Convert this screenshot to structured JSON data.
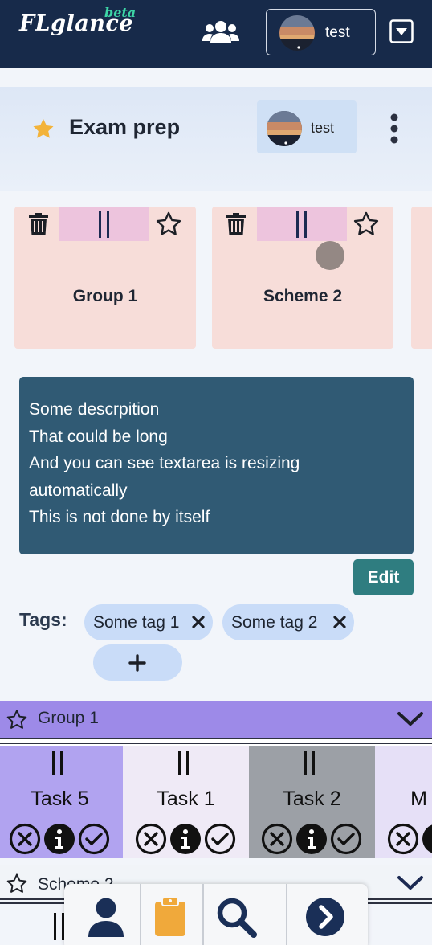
{
  "app": {
    "logo": "FLglance",
    "badge": "beta",
    "accent_dark": "#172a4a"
  },
  "topbar": {
    "username": "test",
    "icons": [
      "users-icon",
      "avatar",
      "dropdown-icon"
    ]
  },
  "header": {
    "title": "Exam prep",
    "owner": "test",
    "starred": true
  },
  "cards": [
    {
      "name": "Group 1"
    },
    {
      "name": "Scheme 2"
    }
  ],
  "description": {
    "lines": [
      "Some descrpition",
      "That could be long",
      "And you can see textarea is resizing",
      "automatically",
      "This is not done by itself"
    ],
    "edit_label": "Edit"
  },
  "tags": {
    "label": "Tags:",
    "items": [
      "Some tag 1",
      "Some tag 2"
    ]
  },
  "groups": [
    {
      "name": "Group 1",
      "color": "#9d8ae8",
      "tasks": [
        {
          "name": "Task 5",
          "bg": "#b1a3f0"
        },
        {
          "name": "Task 1",
          "bg": "#efeaf6"
        },
        {
          "name": "Task 2",
          "bg": "#9ca0a6"
        },
        {
          "name": "M",
          "bg": "#e6e0f7"
        }
      ]
    },
    {
      "name": "Scheme 2"
    }
  ],
  "bottom_nav": [
    "user-icon",
    "clipboard-icon",
    "search-icon",
    "next-icon"
  ]
}
